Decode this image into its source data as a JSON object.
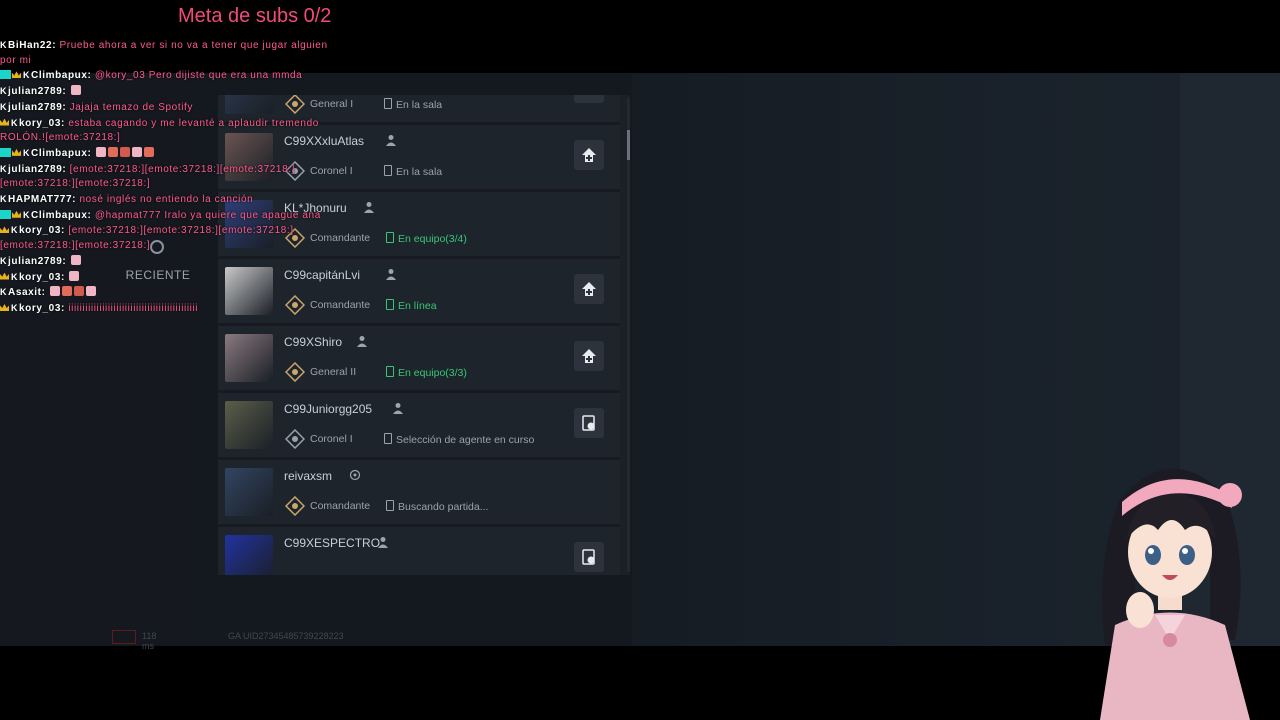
{
  "overlay": {
    "sub_goal": "Meta de subs 0/2"
  },
  "chat": [
    {
      "badges": [
        "k"
      ],
      "user": "BiHan22",
      "message": "Pruebe ahora a ver si no va a tener que jugar alguien por mi"
    },
    {
      "badges": [
        "gc",
        "crown",
        "k"
      ],
      "user": "Climbapux",
      "message": "@kory_03 Pero dijiste que era una mmda",
      "mention": true
    },
    {
      "badges": [
        "k"
      ],
      "user": "julian2789",
      "message": ""
    },
    {
      "badges": [
        "k"
      ],
      "user": "julian2789",
      "message": "Jajaja temazo de Spotify"
    },
    {
      "badges": [
        "crown",
        "k"
      ],
      "user": "kory_03",
      "message": "estaba cagando y me levanté a aplaudir tremendo ROLÓN.![emote:37218:]"
    },
    {
      "badges": [
        "gc",
        "crown",
        "k"
      ],
      "user": "Climbapux",
      "message": ""
    },
    {
      "badges": [
        "k"
      ],
      "user": "julian2789",
      "message": "[emote:37218:][emote:37218:][emote:37218:][emote:37218:][emote:37218:]"
    },
    {
      "badges": [
        "k"
      ],
      "user": "HAPMAT777",
      "message": "nosé inglés no entiendo la canción"
    },
    {
      "badges": [
        "gc",
        "crown",
        "k"
      ],
      "user": "Climbapux",
      "message": "@hapmat777 Iralo ya quiere que apague ana",
      "mention": true
    },
    {
      "badges": [
        "crown",
        "k"
      ],
      "user": "kory_03",
      "message": "[emote:37218:][emote:37218:][emote:37218:][emote:37218:][emote:37218:]"
    },
    {
      "badges": [
        "k"
      ],
      "user": "julian2789",
      "message": ""
    },
    {
      "badges": [
        "crown",
        "k"
      ],
      "user": "kory_03",
      "message": ""
    },
    {
      "badges": [
        "k"
      ],
      "user": "Asaxit",
      "message": ""
    },
    {
      "badges": [
        "crown",
        "k"
      ],
      "user": "kory_03",
      "message": "iiiiiiiiiiiiiiiiiiiiiiiiiiiiiiiiiiiiiiiiiiiiii"
    }
  ],
  "game": {
    "recent_tab": "RECIENTE",
    "footer_ping": "118 ms",
    "footer_uid": "GA UID27345485739228223",
    "friends": [
      {
        "name": "",
        "rank": "General I",
        "status": "En la sala",
        "status_color": "grey",
        "action": "invite-icon"
      },
      {
        "name": "C99XXxluAtlas",
        "rank": "Coronel I",
        "status": "En la sala",
        "status_color": "grey",
        "action": "invite-icon"
      },
      {
        "name": "KL*Jhonuru",
        "rank": "Comandante",
        "status": "En equipo(3/4)",
        "status_color": "green",
        "action": ""
      },
      {
        "name": "C99capitánLvi",
        "rank": "Comandante",
        "status": "En línea",
        "status_color": "green",
        "action": "invite-icon"
      },
      {
        "name": "C99XShiro",
        "rank": "General II",
        "status": "En equipo(3/3)",
        "status_color": "green",
        "action": "invite-icon"
      },
      {
        "name": "C99Juniorgg205",
        "rank": "Coronel I",
        "status": "Selección de agente en curso",
        "status_color": "grey",
        "action": "spectate-icon"
      },
      {
        "name": "reivaxsm",
        "rank": "Comandante",
        "status": "Buscando partida...",
        "status_color": "grey",
        "action": ""
      },
      {
        "name": "C99XESPECTRO",
        "rank": "",
        "status": "",
        "status_color": "grey",
        "action": "spectate-icon"
      }
    ]
  },
  "colors": {
    "chat_message": "#ff5a8c",
    "sub_goal": "#f24a7a",
    "status_green": "#37c776",
    "panel_bg": "#1e242c"
  }
}
